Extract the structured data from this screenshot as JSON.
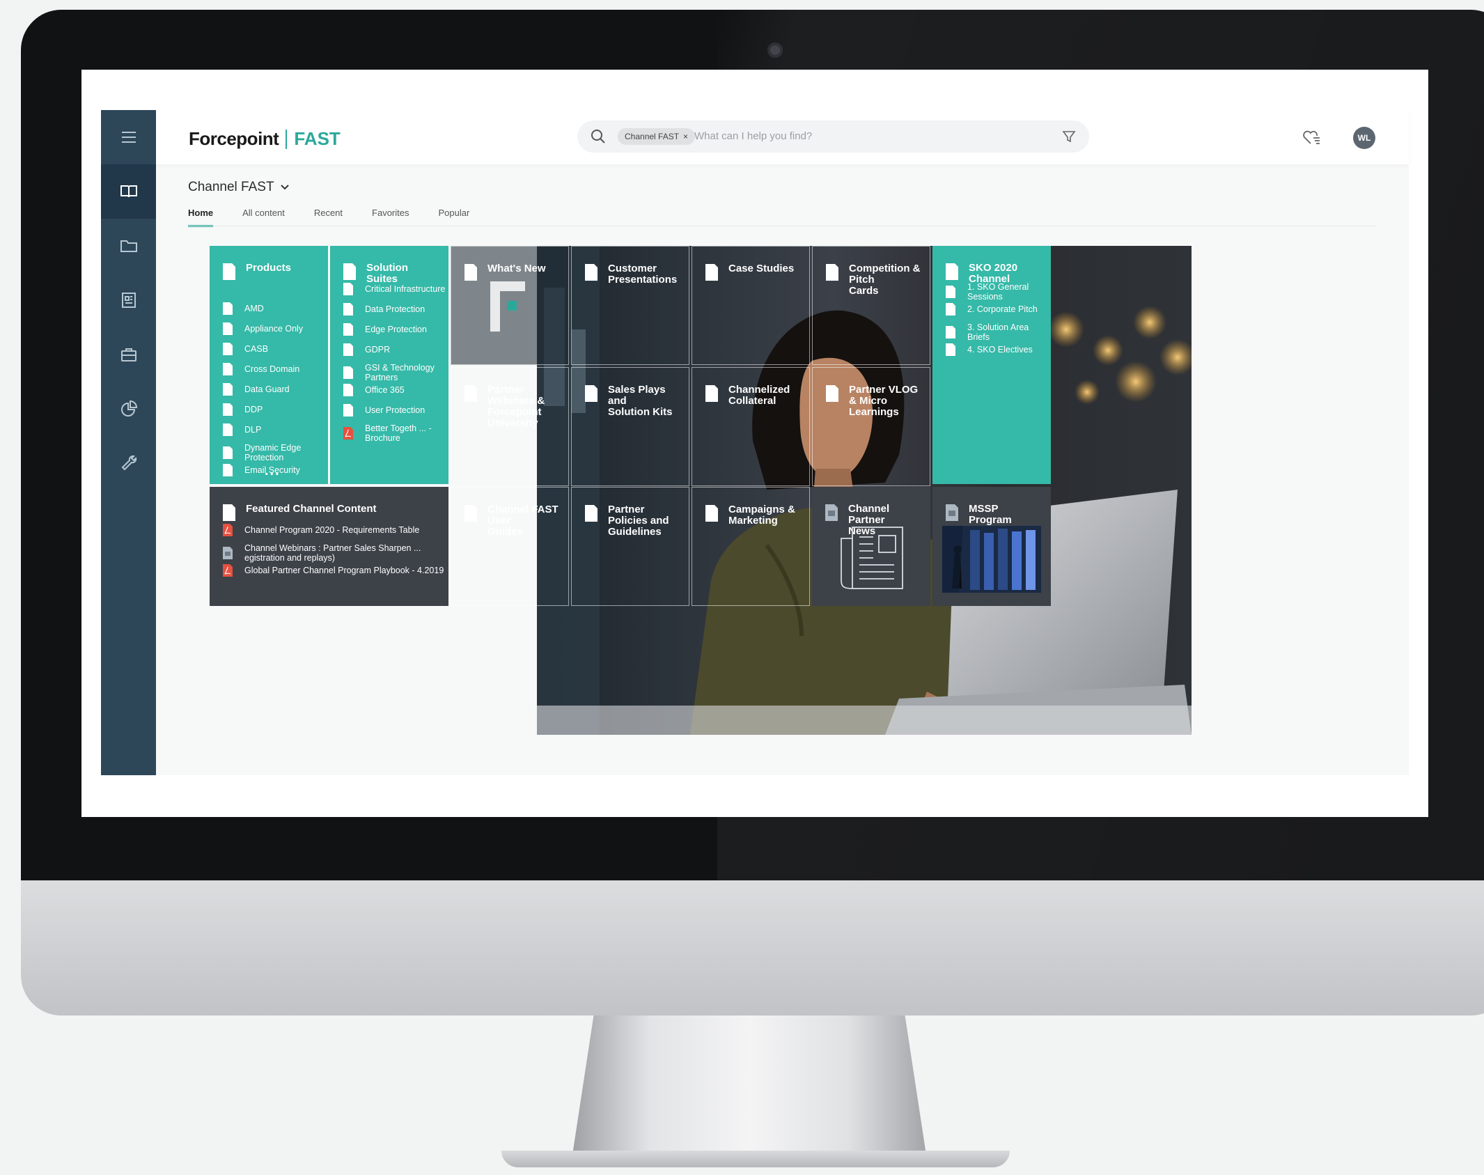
{
  "app": {
    "brand": "Forcepoint",
    "product": "FAST",
    "context_title": "Channel FAST",
    "avatar_initials": "WL",
    "accent_color": "#35b9a8",
    "sidebar_color": "#2d4759"
  },
  "search": {
    "chip_label": "Channel FAST",
    "chip_close": "×",
    "placeholder": "What can I help you find?"
  },
  "sidebar": {
    "items": [
      {
        "icon": "menu-icon"
      },
      {
        "icon": "book-icon",
        "active": true
      },
      {
        "icon": "folder-icon"
      },
      {
        "icon": "newspaper-icon"
      },
      {
        "icon": "briefcase-icon"
      },
      {
        "icon": "pie-chart-icon"
      },
      {
        "icon": "wrench-icon"
      }
    ]
  },
  "tabs": [
    {
      "label": "Home",
      "active": true
    },
    {
      "label": "All content"
    },
    {
      "label": "Recent"
    },
    {
      "label": "Favorites"
    },
    {
      "label": "Popular"
    }
  ],
  "tiles": {
    "products": {
      "title": "Products",
      "items": [
        "AMD",
        "Appliance Only",
        "CASB",
        "Cross Domain",
        "Data Guard",
        "DDP",
        "DLP",
        "Dynamic Edge Protection",
        "Email Security"
      ],
      "more": "..."
    },
    "solution_suites": {
      "title": "Solution Suites",
      "items": [
        "Critical Infrastructure",
        "Data Protection",
        "Edge Protection",
        "GDPR",
        "GSI & Technology Partners",
        "Office 365",
        "User Protection",
        "Better Togeth ... - Brochure"
      ]
    },
    "whats_new": {
      "title": "What's New"
    },
    "customer_presentations": {
      "title_line1": "Customer",
      "title_line2": "Presentations"
    },
    "case_studies": {
      "title": "Case Studies"
    },
    "competition": {
      "title_line1": "Competition & Pitch",
      "title_line2": "Cards"
    },
    "sko": {
      "title": "SKO 2020 Channel",
      "items": [
        "1. SKO General Sessions",
        "2. Corporate Pitch",
        "3. Solution Area Briefs",
        "4. SKO Electives"
      ]
    },
    "webinars": {
      "title_line1": "Partner Webinars &",
      "title_line2": "Forcepoint University"
    },
    "sales_plays": {
      "title_line1": "Sales Plays and",
      "title_line2": "Solution Kits"
    },
    "channelized": {
      "title_line1": "Channelized",
      "title_line2": "Collateral"
    },
    "vlog": {
      "title_line1": "Partner VLOG & Micro",
      "title_line2": "Learnings"
    },
    "featured": {
      "title": "Featured Channel Content",
      "items": [
        {
          "label": "Channel Program 2020 - Requirements Table",
          "icon": "pdf-icon"
        },
        {
          "label": "Channel Webinars : Partner Sales Sharpen ... egistration and replays)",
          "icon": "image-file-icon"
        },
        {
          "label": "Global Partner Channel Program Playbook - 4.2019",
          "icon": "pdf-icon"
        }
      ]
    },
    "user_guides": {
      "title_line1": "Channel FAST User",
      "title_line2": "Guides"
    },
    "policies": {
      "title_line1": "Partner Policies and",
      "title_line2": "Guidelines"
    },
    "campaigns": {
      "title_line1": "Campaigns &",
      "title_line2": "Marketing"
    },
    "partner_news": {
      "title_line1": "Channel Partner",
      "title_line2": "News"
    },
    "mssp": {
      "title": "MSSP Program"
    }
  }
}
